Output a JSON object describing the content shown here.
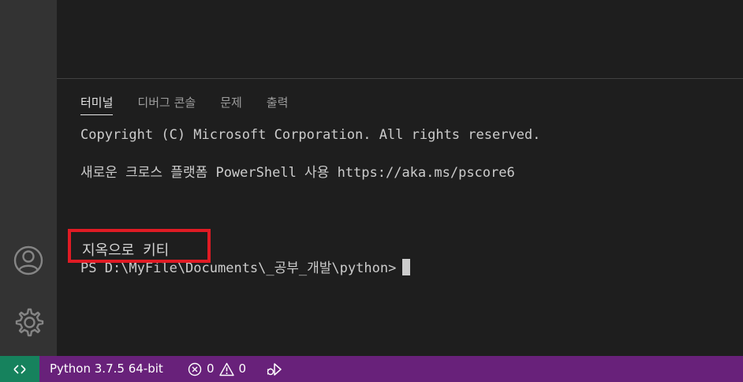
{
  "panel": {
    "tabs": [
      {
        "label": "터미널",
        "active": true
      },
      {
        "label": "디버그 콘솔",
        "active": false
      },
      {
        "label": "문제",
        "active": false
      },
      {
        "label": "출력",
        "active": false
      }
    ]
  },
  "terminal": {
    "lines": [
      "Copyright (C) Microsoft Corporation. All rights reserved.",
      "새로운 크로스 플랫폼 PowerShell 사용 https://aka.ms/pscore6"
    ],
    "prompt": "PS D:\\MyFile\\Documents\\_공부_개발\\python>"
  },
  "annotation": {
    "text": "지옥으로 키티",
    "color": "#e01b24"
  },
  "statusbar": {
    "python": "Python 3.7.5 64-bit",
    "errors": "0",
    "warnings": "0"
  },
  "colors": {
    "statusbar": "#68217a",
    "remote": "#16825d",
    "activity_bar": "#333333",
    "background": "#1e1e1e"
  },
  "icons": {
    "remote": "remote-icon",
    "account": "account-icon",
    "settings": "gear-icon",
    "error": "error-icon",
    "warning": "warning-icon",
    "debug": "debug-icon"
  }
}
